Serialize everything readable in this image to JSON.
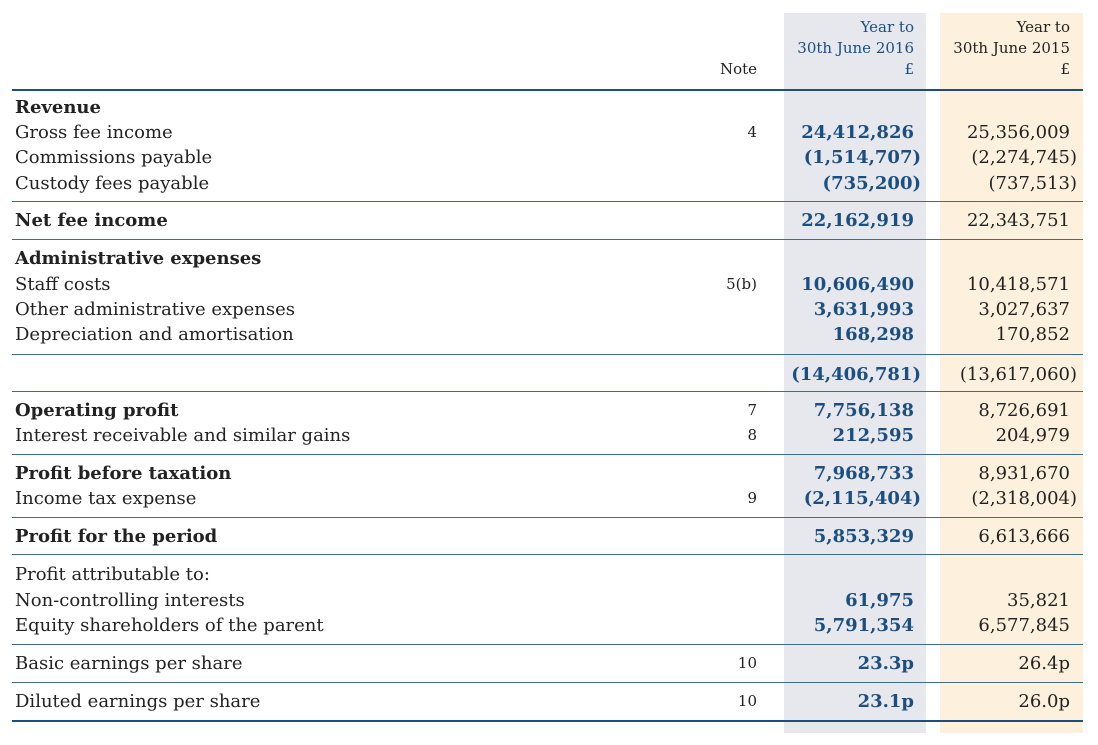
{
  "header": {
    "note": "Note",
    "col_2016": [
      "Year to",
      "30th June 2016",
      "£"
    ],
    "col_2015": [
      "Year to",
      "30th June 2015",
      "£"
    ]
  },
  "sections": {
    "revenue": {
      "title": "Revenue",
      "rows": [
        {
          "label": "Gross fee income",
          "note": "4",
          "v2016": "24,412,826",
          "v2015": "25,356,009"
        },
        {
          "label": "Commissions payable",
          "note": "",
          "v2016": "(1,514,707)",
          "v2015": "(2,274,745)"
        },
        {
          "label": "Custody fees payable",
          "note": "",
          "v2016": "(735,200)",
          "v2015": "(737,513)"
        }
      ]
    },
    "net_fee": {
      "label": "Net fee income",
      "v2016": "22,162,919",
      "v2015": "22,343,751"
    },
    "admin": {
      "title": "Administrative expenses",
      "rows": [
        {
          "label": "Staff costs",
          "note": "5(b)",
          "v2016": "10,606,490",
          "v2015": "10,418,571"
        },
        {
          "label": "Other administrative expenses",
          "note": "",
          "v2016": "3,631,993",
          "v2015": "3,027,637"
        },
        {
          "label": "Depreciation and amortisation",
          "note": "",
          "v2016": "168,298",
          "v2015": "170,852"
        }
      ],
      "total": {
        "v2016": "(14,406,781)",
        "v2015": "(13,617,060)"
      }
    },
    "operating": [
      {
        "label": "Operating profit",
        "note": "7",
        "v2016": "7,756,138",
        "v2015": "8,726,691"
      },
      {
        "label": "Interest receivable and similar gains",
        "note": "8",
        "v2016": "212,595",
        "v2015": "204,979"
      }
    ],
    "pbt": [
      {
        "label": "Profit before taxation",
        "note": "",
        "v2016": "7,968,733",
        "v2015": "8,931,670"
      },
      {
        "label": "Income tax expense",
        "note": "9",
        "v2016": "(2,115,404)",
        "v2015": "(2,318,004)"
      }
    ],
    "profit_period": {
      "label": "Profit for the period",
      "v2016": "5,853,329",
      "v2015": "6,613,666"
    },
    "attributable": {
      "title": "Profit attributable to:",
      "rows": [
        {
          "label": "Non-controlling interests",
          "v2016": "61,975",
          "v2015": "35,821"
        },
        {
          "label": "Equity shareholders of the parent",
          "v2016": "5,791,354",
          "v2015": "6,577,845"
        }
      ]
    },
    "basic_eps": {
      "label": "Basic earnings per share",
      "note": "10",
      "v2016": "23.3p",
      "v2015": "26.4p"
    },
    "diluted_eps": {
      "label": "Diluted earnings per share",
      "note": "10",
      "v2016": "23.1p",
      "v2015": "26.0p"
    }
  }
}
